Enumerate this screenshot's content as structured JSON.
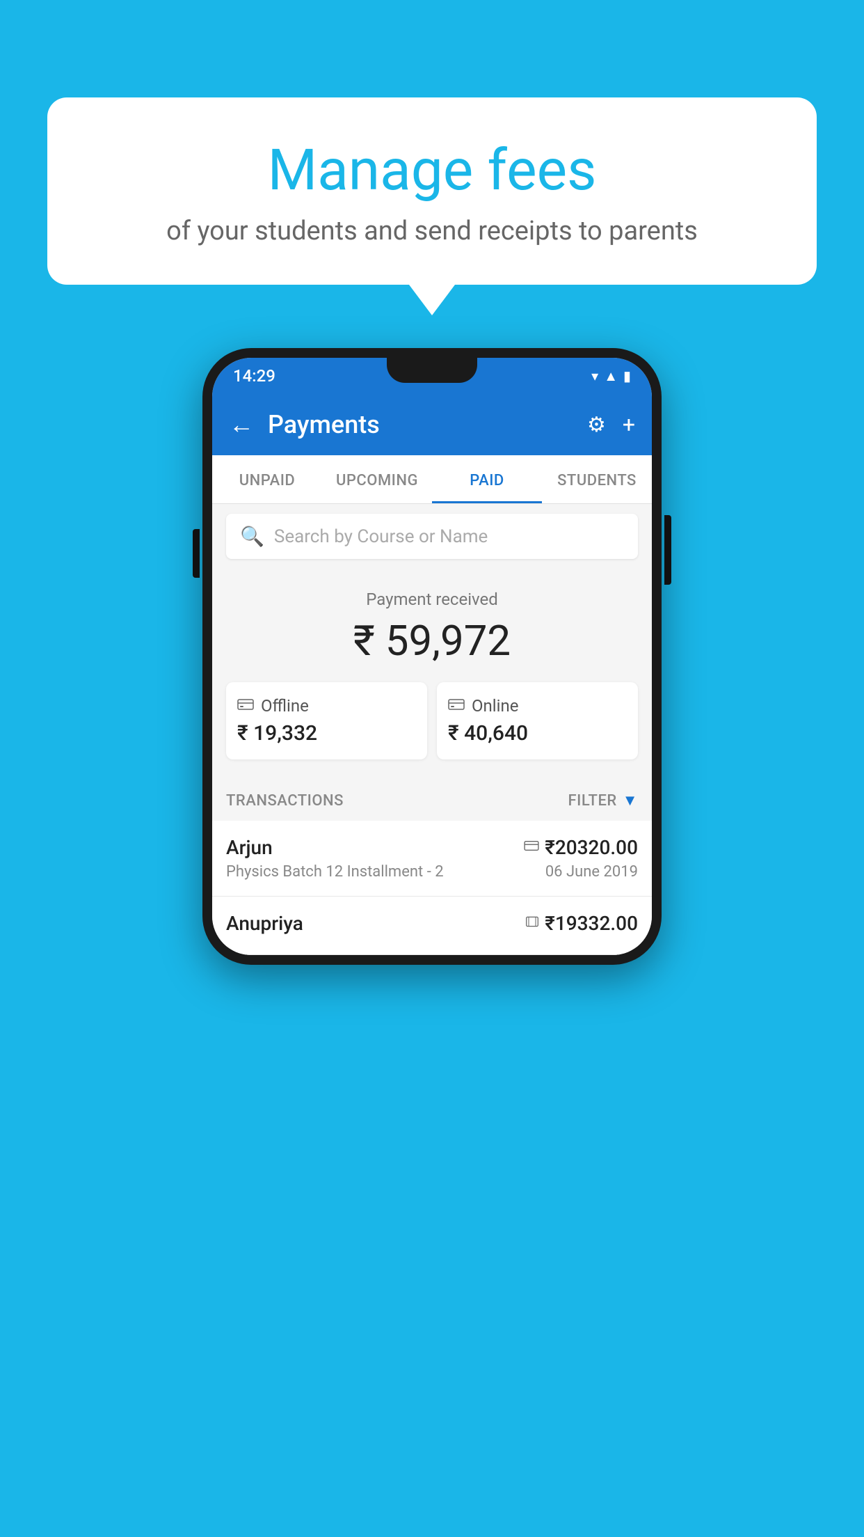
{
  "background_color": "#1ab6e8",
  "speech_bubble": {
    "title": "Manage fees",
    "subtitle": "of your students and send receipts to parents"
  },
  "phone": {
    "status_bar": {
      "time": "14:29",
      "wifi": "▼",
      "signal": "▲",
      "battery": "▌"
    },
    "app_bar": {
      "title": "Payments",
      "back_label": "←",
      "gear_label": "⚙",
      "plus_label": "+"
    },
    "tabs": [
      {
        "label": "UNPAID",
        "active": false
      },
      {
        "label": "UPCOMING",
        "active": false
      },
      {
        "label": "PAID",
        "active": true
      },
      {
        "label": "STUDENTS",
        "active": false
      }
    ],
    "search": {
      "placeholder": "Search by Course or Name"
    },
    "payment_summary": {
      "label": "Payment received",
      "total": "₹ 59,972",
      "offline": {
        "icon": "💳",
        "label": "Offline",
        "amount": "₹ 19,332"
      },
      "online": {
        "icon": "💳",
        "label": "Online",
        "amount": "₹ 40,640"
      }
    },
    "transactions_section": {
      "label": "TRANSACTIONS",
      "filter_label": "FILTER"
    },
    "transactions": [
      {
        "name": "Arjun",
        "amount": "₹20320.00",
        "course": "Physics Batch 12 Installment - 2",
        "date": "06 June 2019",
        "icon_type": "card"
      },
      {
        "name": "Anupriya",
        "amount": "₹19332.00",
        "course": "",
        "date": "",
        "icon_type": "cash"
      }
    ]
  }
}
